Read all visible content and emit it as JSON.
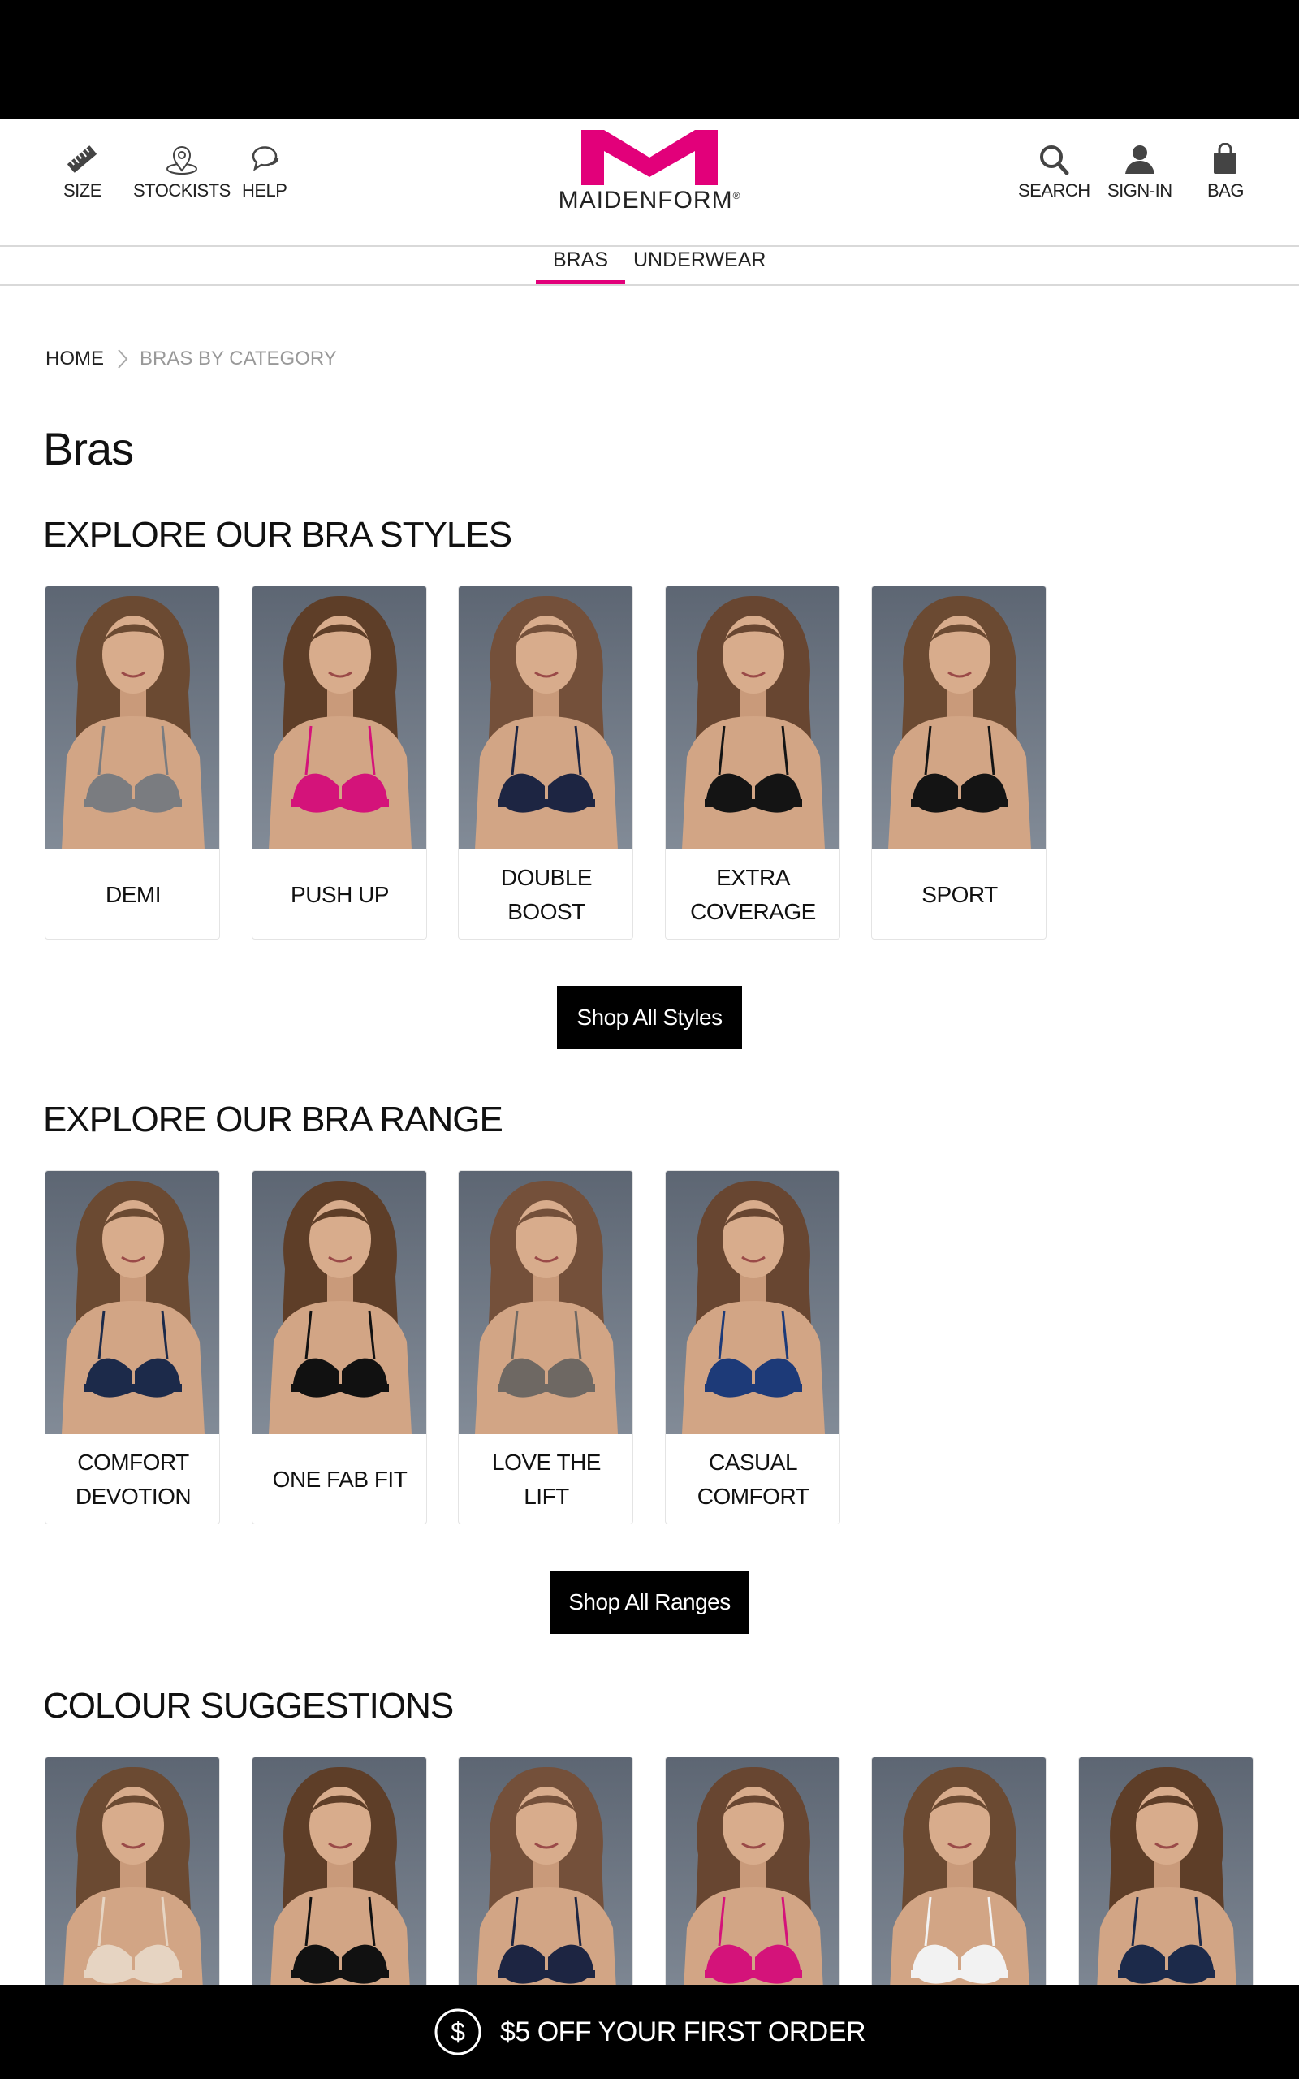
{
  "brand": {
    "name": "MAIDENFORM",
    "accent": "#e2007a"
  },
  "header": {
    "left": [
      {
        "label": "SIZE",
        "icon": "ruler-icon"
      },
      {
        "label": "STOCKISTS",
        "icon": "location-pin-icon"
      },
      {
        "label": "HELP",
        "icon": "chat-bubble-icon"
      }
    ],
    "right": [
      {
        "label": "SEARCH",
        "icon": "search-icon"
      },
      {
        "label": "SIGN-IN",
        "icon": "user-icon"
      },
      {
        "label": "BAG",
        "icon": "shopping-bag-icon"
      }
    ]
  },
  "category_nav": {
    "tabs": [
      {
        "label": "BRAS",
        "active": true
      },
      {
        "label": "UNDERWEAR",
        "active": false
      }
    ]
  },
  "breadcrumb": {
    "home": "HOME",
    "current": "BRAS BY CATEGORY"
  },
  "page_title": "Bras",
  "styles": {
    "title": "EXPLORE OUR BRA STYLES",
    "cards": [
      {
        "label": "DEMI",
        "bra_color": "#7a7c80"
      },
      {
        "label": "PUSH UP",
        "bra_color": "#d4137a"
      },
      {
        "label": "DOUBLE BOOST",
        "bra_color": "#1d2542"
      },
      {
        "label": "EXTRA COVERAGE",
        "bra_color": "#141414"
      },
      {
        "label": "SPORT",
        "bra_color": "#141414"
      }
    ],
    "button": "Shop All Styles"
  },
  "ranges": {
    "title": "EXPLORE OUR BRA RANGE",
    "cards": [
      {
        "label": "COMFORT DEVOTION",
        "bra_color": "#1c2a4a"
      },
      {
        "label": "ONE FAB FIT",
        "bra_color": "#111111"
      },
      {
        "label": "LOVE THE LIFT",
        "bra_color": "#6e6863"
      },
      {
        "label": "CASUAL COMFORT",
        "bra_color": "#1d3a78"
      }
    ],
    "button": "Shop All Ranges"
  },
  "colours": {
    "title": "COLOUR SUGGESTIONS",
    "swatches": [
      {
        "bra_color": "#e6d4c2"
      },
      {
        "bra_color": "#111111"
      },
      {
        "bra_color": "#1d2542"
      },
      {
        "bra_color": "#d4137a"
      },
      {
        "bra_color": "#f2f2f2"
      },
      {
        "bra_color": "#1c2a4a"
      }
    ]
  },
  "promo": {
    "text": "$5 OFF YOUR FIRST ORDER",
    "icon": "dollar-circle-icon"
  }
}
